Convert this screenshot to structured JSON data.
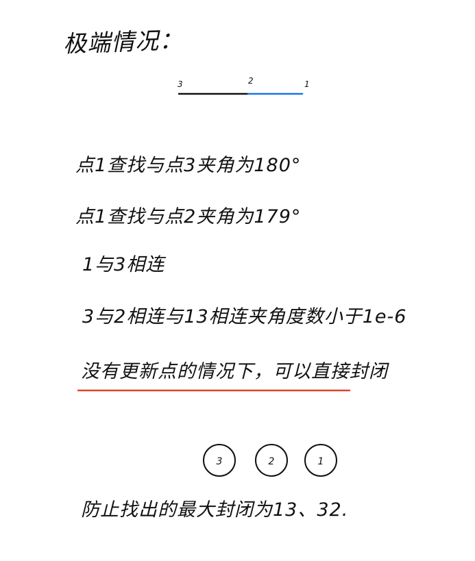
{
  "title": "极端情况：",
  "segment_diagram": {
    "points": [
      "3",
      "2",
      "1"
    ],
    "colors": {
      "segment_3_2": "#111111",
      "segment_2_1": "#1a73e8"
    }
  },
  "notes": [
    "点1查找与点3夹角为180°",
    "点1查找与点2夹角为179°",
    "1与3相连",
    "3与2相连与13相连夹角度数小于1e-6",
    "没有更新点的情况下，可以直接封闭"
  ],
  "emphasis_color": "#e0442e",
  "circle_nodes": [
    "3",
    "2",
    "1"
  ],
  "conclusion": "防止找出的最大封闭为13、32."
}
